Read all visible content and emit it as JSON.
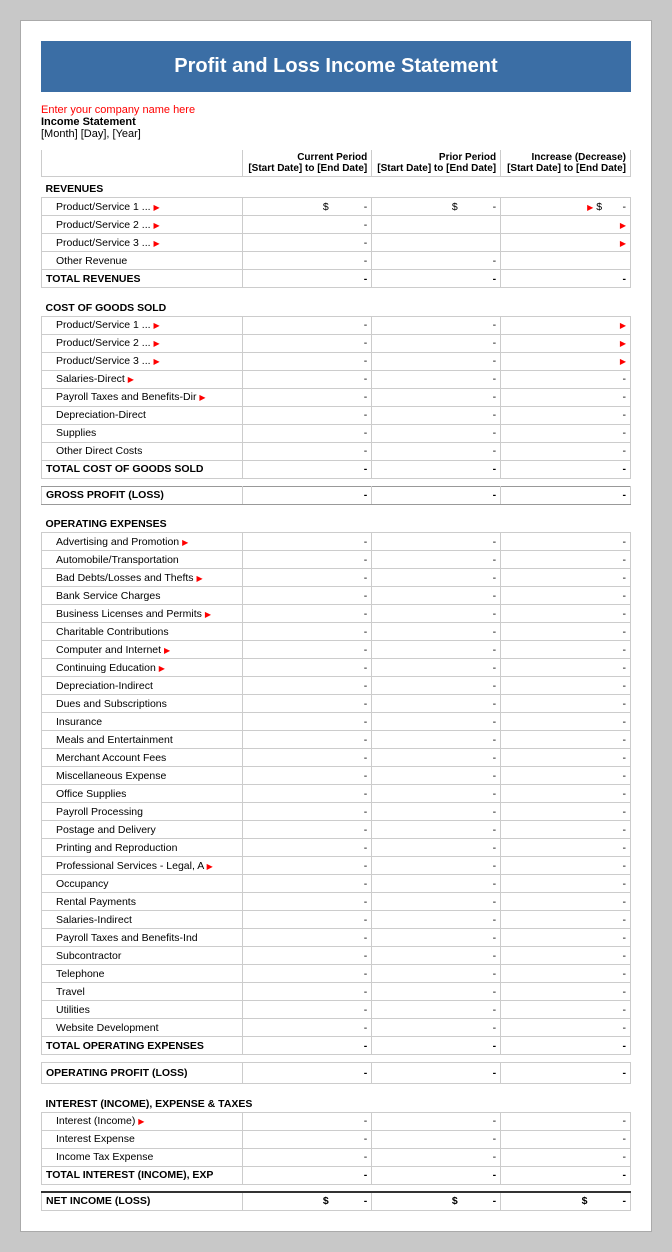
{
  "title": "Profit and Loss Income Statement",
  "company": {
    "name_placeholder": "Enter your company name here",
    "statement_title": "Income Statement",
    "date_line": "[Month] [Day], [Year]"
  },
  "columns": {
    "current_period_label": "Current Period",
    "current_period_date": "[Start Date] to [End Date]",
    "prior_period_label": "Prior Period",
    "prior_period_date": "[Start Date] to [End Date]",
    "increase_label": "Increase (Decrease)",
    "increase_date": "[Start Date] to [End Date]"
  },
  "sections": {
    "revenues_header": "REVENUES",
    "revenues": [
      {
        "label": "Product/Service 1 ...",
        "has_marker": true,
        "cur": "$     -",
        "prior": "$     -",
        "inc": "$     -"
      },
      {
        "label": "Product/Service 2 ...",
        "has_marker": true,
        "cur": "-",
        "prior": "",
        "inc": ""
      },
      {
        "label": "Product/Service 3 ...",
        "has_marker": true,
        "cur": "-",
        "prior": "",
        "inc": ""
      },
      {
        "label": "Other Revenue",
        "has_marker": false,
        "cur": "-",
        "prior": "-",
        "inc": ""
      }
    ],
    "total_revenues": "TOTAL REVENUES",
    "cogs_header": "COST OF GOODS SOLD",
    "cogs": [
      {
        "label": "Product/Service 1 ...",
        "has_marker": true
      },
      {
        "label": "Product/Service 2 ...",
        "has_marker": true
      },
      {
        "label": "Product/Service 3 ...",
        "has_marker": true
      },
      {
        "label": "Salaries-Direct",
        "has_marker": true
      },
      {
        "label": "Payroll Taxes and Benefits-Dir",
        "has_marker": true
      },
      {
        "label": "Depreciation-Direct",
        "has_marker": false
      },
      {
        "label": "Supplies",
        "has_marker": false
      },
      {
        "label": "Other Direct Costs",
        "has_marker": false
      }
    ],
    "total_cogs": "TOTAL COST OF GOODS SOLD",
    "gross_profit": "GROSS PROFIT (LOSS)",
    "opex_header": "OPERATING EXPENSES",
    "opex": [
      {
        "label": "Advertising and Promotion",
        "has_marker": true
      },
      {
        "label": "Automobile/Transportation",
        "has_marker": false
      },
      {
        "label": "Bad Debts/Losses and Thefts",
        "has_marker": true
      },
      {
        "label": "Bank Service Charges",
        "has_marker": false
      },
      {
        "label": "Business Licenses and Permits",
        "has_marker": true
      },
      {
        "label": "Charitable Contributions",
        "has_marker": false
      },
      {
        "label": "Computer and Internet",
        "has_marker": true
      },
      {
        "label": "Continuing Education",
        "has_marker": true
      },
      {
        "label": "Depreciation-Indirect",
        "has_marker": false
      },
      {
        "label": "Dues and Subscriptions",
        "has_marker": false
      },
      {
        "label": "Insurance",
        "has_marker": false
      },
      {
        "label": "Meals and Entertainment",
        "has_marker": false
      },
      {
        "label": "Merchant Account Fees",
        "has_marker": false
      },
      {
        "label": "Miscellaneous Expense",
        "has_marker": false
      },
      {
        "label": "Office Supplies",
        "has_marker": false
      },
      {
        "label": "Payroll Processing",
        "has_marker": false
      },
      {
        "label": "Postage and Delivery",
        "has_marker": false
      },
      {
        "label": "Printing and Reproduction",
        "has_marker": false
      },
      {
        "label": "Professional Services - Legal, A",
        "has_marker": true
      },
      {
        "label": "Occupancy",
        "has_marker": false
      },
      {
        "label": "Rental Payments",
        "has_marker": false
      },
      {
        "label": "Salaries-Indirect",
        "has_marker": false
      },
      {
        "label": "Payroll Taxes and Benefits-Ind",
        "has_marker": false
      },
      {
        "label": "Subcontractor",
        "has_marker": false
      },
      {
        "label": "Telephone",
        "has_marker": false
      },
      {
        "label": "Travel",
        "has_marker": false
      },
      {
        "label": "Utilities",
        "has_marker": false
      },
      {
        "label": "Website Development",
        "has_marker": false
      }
    ],
    "total_opex": "TOTAL OPERATING EXPENSES",
    "operating_profit": "OPERATING PROFIT (LOSS)",
    "interest_header": "INTEREST (INCOME), EXPENSE & TAXES",
    "interest": [
      {
        "label": "Interest (Income)",
        "has_marker": true
      },
      {
        "label": "Interest Expense",
        "has_marker": false
      },
      {
        "label": "Income Tax Expense",
        "has_marker": false
      }
    ],
    "total_interest": "TOTAL INTEREST (INCOME), EXP",
    "net_income": "NET INCOME (LOSS)",
    "dash": "-"
  }
}
